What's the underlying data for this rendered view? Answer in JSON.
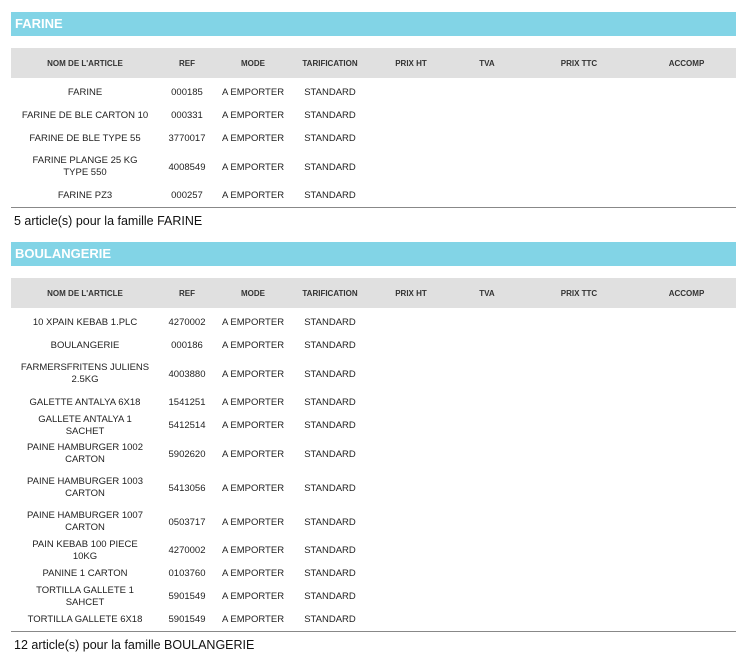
{
  "columns": [
    "NOM DE L'ARTICLE",
    "REF",
    "MODE",
    "TARIFICATION",
    "PRIX HT",
    "TVA",
    "PRIX TTC",
    "ACCOMP"
  ],
  "sections": [
    {
      "title": "FARINE",
      "summary": "5 article(s) pour la famille FARINE",
      "rows": [
        {
          "name": "FARINE",
          "ref": "000185",
          "mode": "A EMPORTER",
          "tarif": "STANDARD"
        },
        {
          "name": "FARINE  DE BLE CARTON 10",
          "ref": "000331",
          "mode": "A EMPORTER",
          "tarif": "STANDARD"
        },
        {
          "name": "FARINE DE BLE TYPE 55",
          "ref": "3770017",
          "mode": "A EMPORTER",
          "tarif": "STANDARD"
        },
        {
          "name": "FARINE PLANGE 25 KG TYPE 550",
          "ref": "4008549",
          "mode": "A EMPORTER",
          "tarif": "STANDARD"
        },
        {
          "name": "FARINE PZ3",
          "ref": "000257",
          "mode": "A EMPORTER",
          "tarif": "STANDARD"
        }
      ]
    },
    {
      "title": "BOULANGERIE",
      "summary": "12 article(s) pour la famille BOULANGERIE",
      "rows": [
        {
          "name": "10 XPAIN KEBAB 1.PLC",
          "ref": "4270002",
          "mode": "A EMPORTER",
          "tarif": "STANDARD"
        },
        {
          "name": "BOULANGERIE",
          "ref": "000186",
          "mode": "A EMPORTER",
          "tarif": "STANDARD"
        },
        {
          "name": "FARMERSFRITENS JULIENS 2.5KG",
          "ref": "4003880",
          "mode": "A EMPORTER",
          "tarif": "STANDARD"
        },
        {
          "name": "GALETTE ANTALYA  6X18",
          "ref": "1541251",
          "mode": "A EMPORTER",
          "tarif": "STANDARD"
        },
        {
          "name": "GALLETE ANTALYA  1 SACHET",
          "ref": "5412514",
          "mode": "A EMPORTER",
          "tarif": "STANDARD"
        },
        {
          "name": "PAINE HAMBURGER 1002 CARTON",
          "ref": "5902620",
          "mode": "A EMPORTER",
          "tarif": "STANDARD"
        },
        {
          "name": "PAINE HAMBURGER 1003 CARTON",
          "ref": "5413056",
          "mode": "A EMPORTER",
          "tarif": "STANDARD"
        },
        {
          "name": "PAINE HAMBURGER 1007 CARTON",
          "ref": "0503717",
          "mode": "A EMPORTER",
          "tarif": "STANDARD"
        },
        {
          "name": "PAIN KEBAB 100 PIECE  10KG",
          "ref": "4270002",
          "mode": "A EMPORTER",
          "tarif": "STANDARD"
        },
        {
          "name": "PANINE  1 CARTON",
          "ref": "0103760",
          "mode": "A EMPORTER",
          "tarif": "STANDARD"
        },
        {
          "name": "TORTILLA GALLETE  1 SAHCET",
          "ref": "5901549",
          "mode": "A EMPORTER",
          "tarif": "STANDARD"
        },
        {
          "name": "TORTILLA GALLETE 6X18",
          "ref": "5901549",
          "mode": "A EMPORTER",
          "tarif": "STANDARD"
        }
      ]
    }
  ]
}
